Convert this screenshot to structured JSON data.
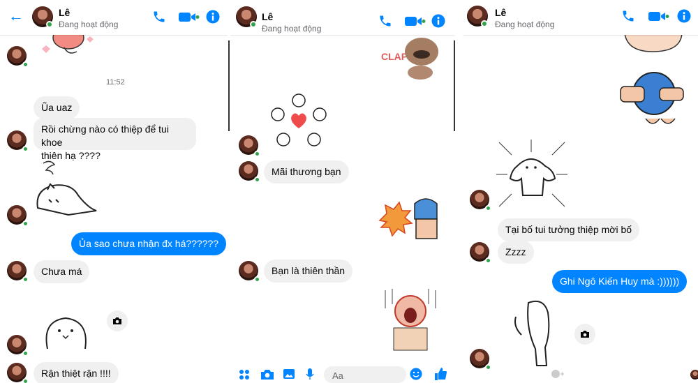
{
  "contact": {
    "name": "Lê",
    "status": "Đang hoạt động"
  },
  "colors": {
    "accent": "#0084ff",
    "online": "#31a24c",
    "bubble_in": "#f0f0f0"
  },
  "header_icons": [
    "back-arrow-icon",
    "phone-icon",
    "video-camera-icon",
    "info-icon"
  ],
  "panel1": {
    "timestamp": "11:52",
    "messages": [
      {
        "text": "Ũa uaz"
      },
      {
        "text": "Rồi chừng nào có thiệp để tui khoe"
      },
      {
        "text": "thiên hạ ????"
      },
      {
        "text": "Ủa sao chưa nhận đx há??????"
      },
      {
        "text": "Chưa má"
      },
      {
        "text": "Rận thiệt rận !!!!"
      }
    ]
  },
  "panel2": {
    "messages": [
      {
        "text": "Mãi thương bạn"
      },
      {
        "text": "Bạn là thiên thần"
      }
    ],
    "composer": {
      "placeholder": "Aa"
    }
  },
  "panel3": {
    "messages": [
      {
        "text": "Tại bố tui tưởng thiệp mời bố"
      },
      {
        "text": "Zzzz"
      },
      {
        "text": "Ghi Ngô Kiến Huy mà :))))))"
      }
    ]
  }
}
